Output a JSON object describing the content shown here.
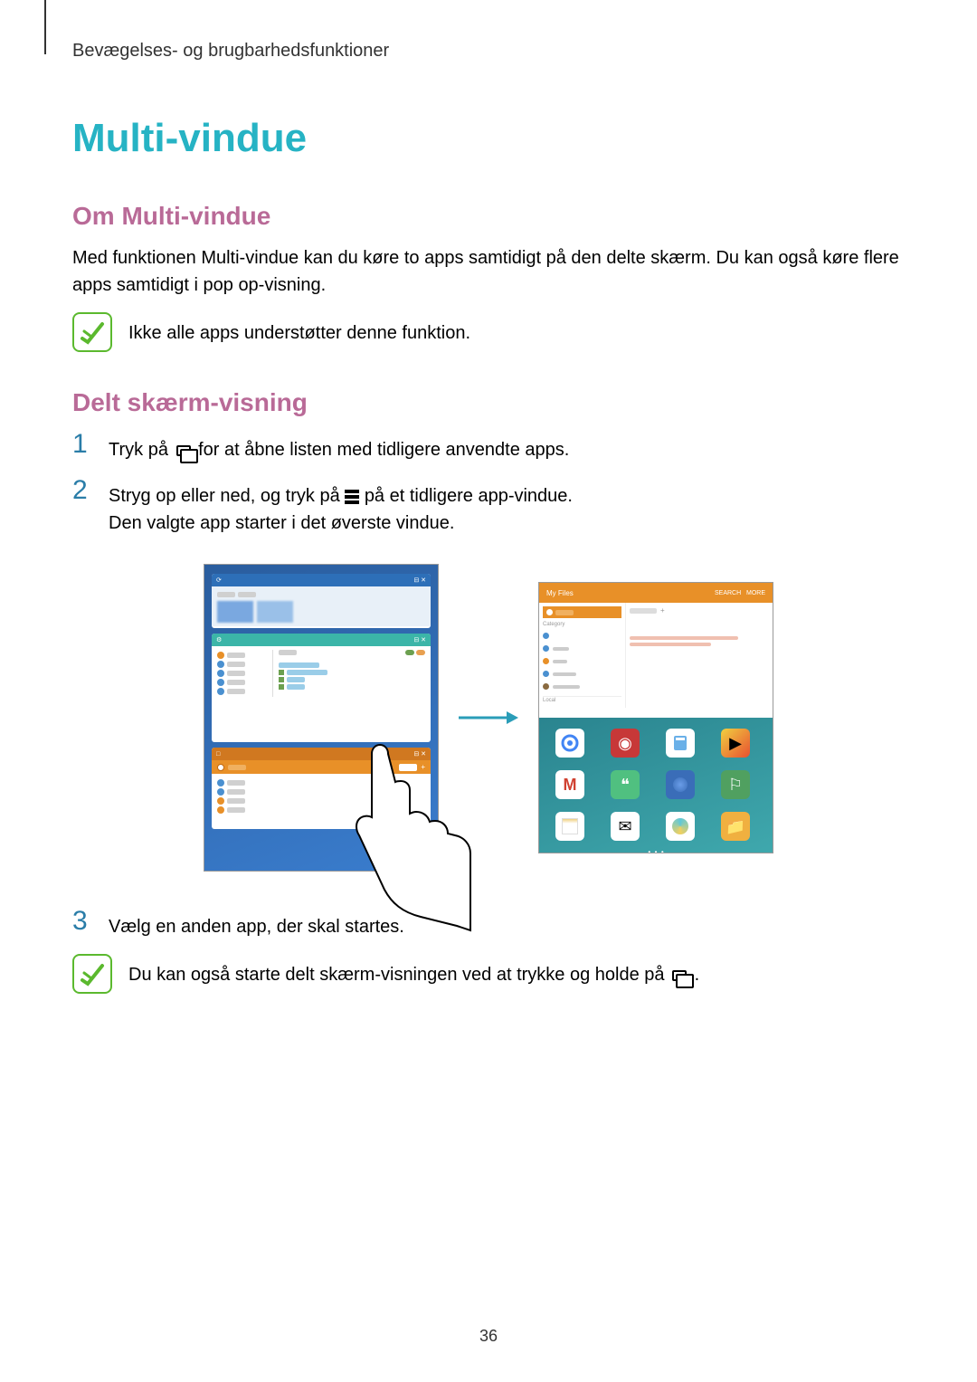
{
  "breadcrumb": "Bevægelses- og brugbarhedsfunktioner",
  "title": "Multi-vindue",
  "section1": {
    "heading": "Om Multi-vindue",
    "paragraph": "Med funktionen Multi-vindue kan du køre to apps samtidigt på den delte skærm. Du kan også køre flere apps samtidigt i pop op-visning.",
    "note": "Ikke alle apps understøtter denne funktion."
  },
  "section2": {
    "heading": "Delt skærm-visning",
    "step1_num": "1",
    "step1_before": "Tryk på ",
    "step1_after": " for at åbne listen med tidligere anvendte apps.",
    "step2_num": "2",
    "step2_before": "Stryg op eller ned, og tryk på ",
    "step2_after": " på et tidligere app-vindue.",
    "step2_line2": "Den valgte app starter i det øverste vindue.",
    "step3_num": "3",
    "step3_text": "Vælg en anden app, der skal startes.",
    "note2_before": "Du kan også starte delt skærm-visningen ved at trykke og holde på ",
    "note2_after": "."
  },
  "page_number": "36"
}
